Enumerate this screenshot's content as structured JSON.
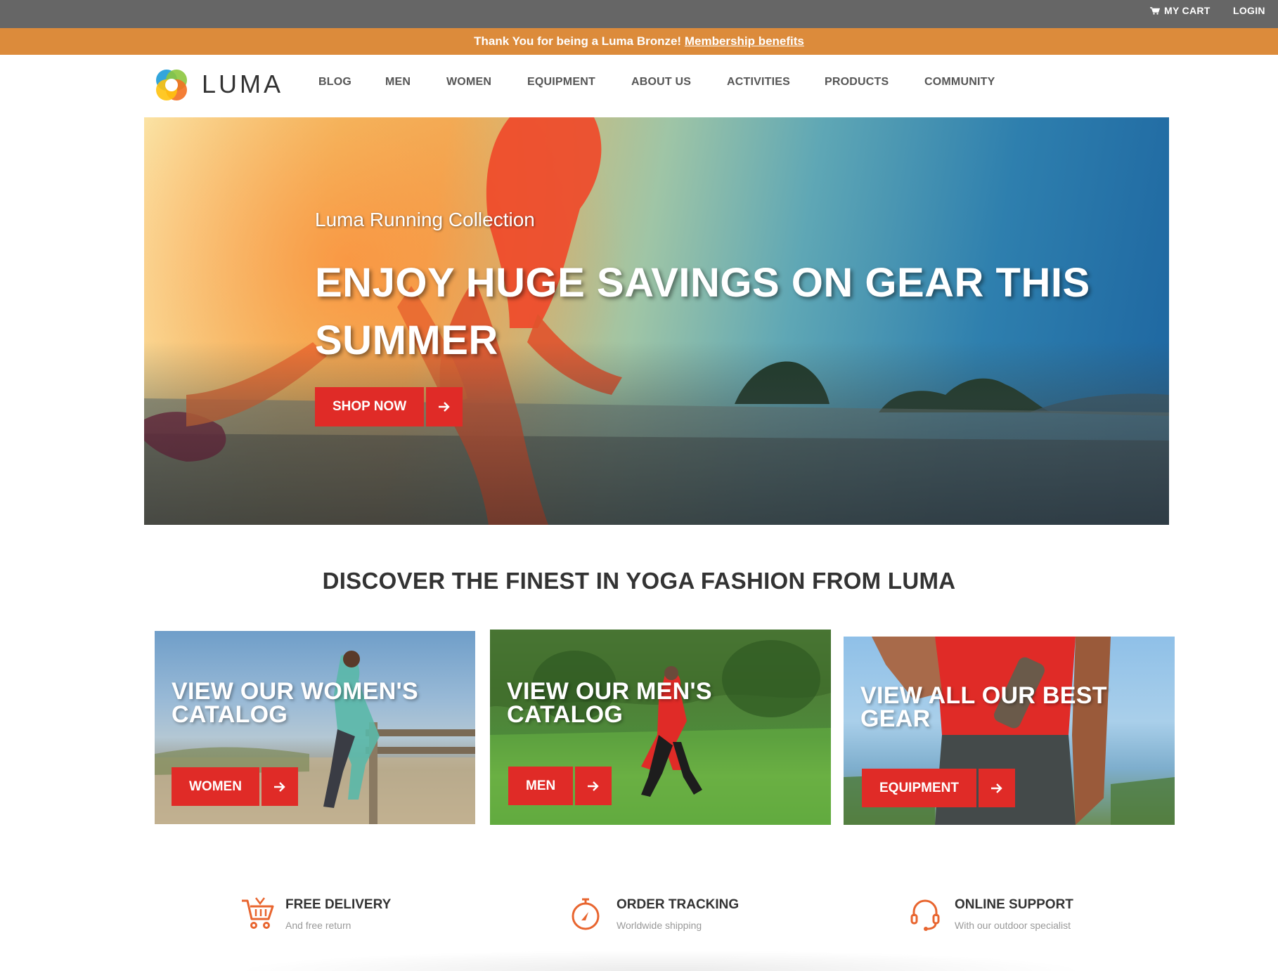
{
  "utility": {
    "cart_label": "MY CART",
    "login_label": "LOGIN"
  },
  "promo": {
    "message": "Thank You for being a Luma Bronze!",
    "link_label": "Membership benefits"
  },
  "brand": {
    "name": "LUMA",
    "accent_color": "#e02b27",
    "promo_color": "#dc8b3b"
  },
  "nav": {
    "items": [
      "BLOG",
      "MEN",
      "WOMEN",
      "EQUIPMENT",
      "ABOUT US",
      "ACTIVITIES",
      "PRODUCTS",
      "COMMUNITY"
    ]
  },
  "hero": {
    "subtitle": "Luma Running Collection",
    "title": "ENJOY HUGE SAVINGS ON GEAR THIS SUMMER",
    "cta_label": "SHOP NOW",
    "cta_icon": "arrow-right-icon"
  },
  "discover": {
    "heading": "DISCOVER THE FINEST IN YOGA FASHION FROM LUMA"
  },
  "tiles": [
    {
      "title": "VIEW OUR WOMEN'S CATALOG",
      "cta_label": "WOMEN"
    },
    {
      "title": "VIEW OUR MEN'S CATALOG",
      "cta_label": "MEN"
    },
    {
      "title": "VIEW ALL OUR BEST GEAR",
      "cta_label": "EQUIPMENT"
    }
  ],
  "features": [
    {
      "icon": "cart-icon",
      "title": "FREE DELIVERY",
      "subtitle": "And free return"
    },
    {
      "icon": "stopwatch-icon",
      "title": "ORDER TRACKING",
      "subtitle": "Worldwide shipping"
    },
    {
      "icon": "headset-icon",
      "title": "ONLINE SUPPORT",
      "subtitle": "With our outdoor specialist"
    }
  ]
}
